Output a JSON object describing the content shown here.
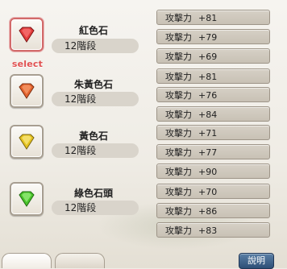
{
  "gems": [
    {
      "name": "紅色石",
      "level": "12階段",
      "color": "#e23b3b",
      "selected": true,
      "selected_label": "select",
      "stats": [
        {
          "label": "攻擊力",
          "value": "+81"
        },
        {
          "label": "攻擊力",
          "value": "+79"
        },
        {
          "label": "攻擊力",
          "value": "+69"
        }
      ]
    },
    {
      "name": "朱黃色石",
      "level": "12階段",
      "color": "#e2622d",
      "selected": false,
      "stats": [
        {
          "label": "攻擊力",
          "value": "+81"
        },
        {
          "label": "攻擊力",
          "value": "+76"
        },
        {
          "label": "攻擊力",
          "value": "+84"
        }
      ]
    },
    {
      "name": "黃色石",
      "level": "12階段",
      "color": "#e4c21f",
      "selected": false,
      "stats": [
        {
          "label": "攻擊力",
          "value": "+71"
        },
        {
          "label": "攻擊力",
          "value": "+77"
        },
        {
          "label": "攻擊力",
          "value": "+90"
        }
      ]
    },
    {
      "name": "綠色石頭",
      "level": "12階段",
      "color": "#49c22a",
      "selected": false,
      "stats": [
        {
          "label": "攻擊力",
          "value": "+70"
        },
        {
          "label": "攻擊力",
          "value": "+86"
        },
        {
          "label": "攻擊力",
          "value": "+83"
        }
      ]
    }
  ],
  "help_button": "說明"
}
